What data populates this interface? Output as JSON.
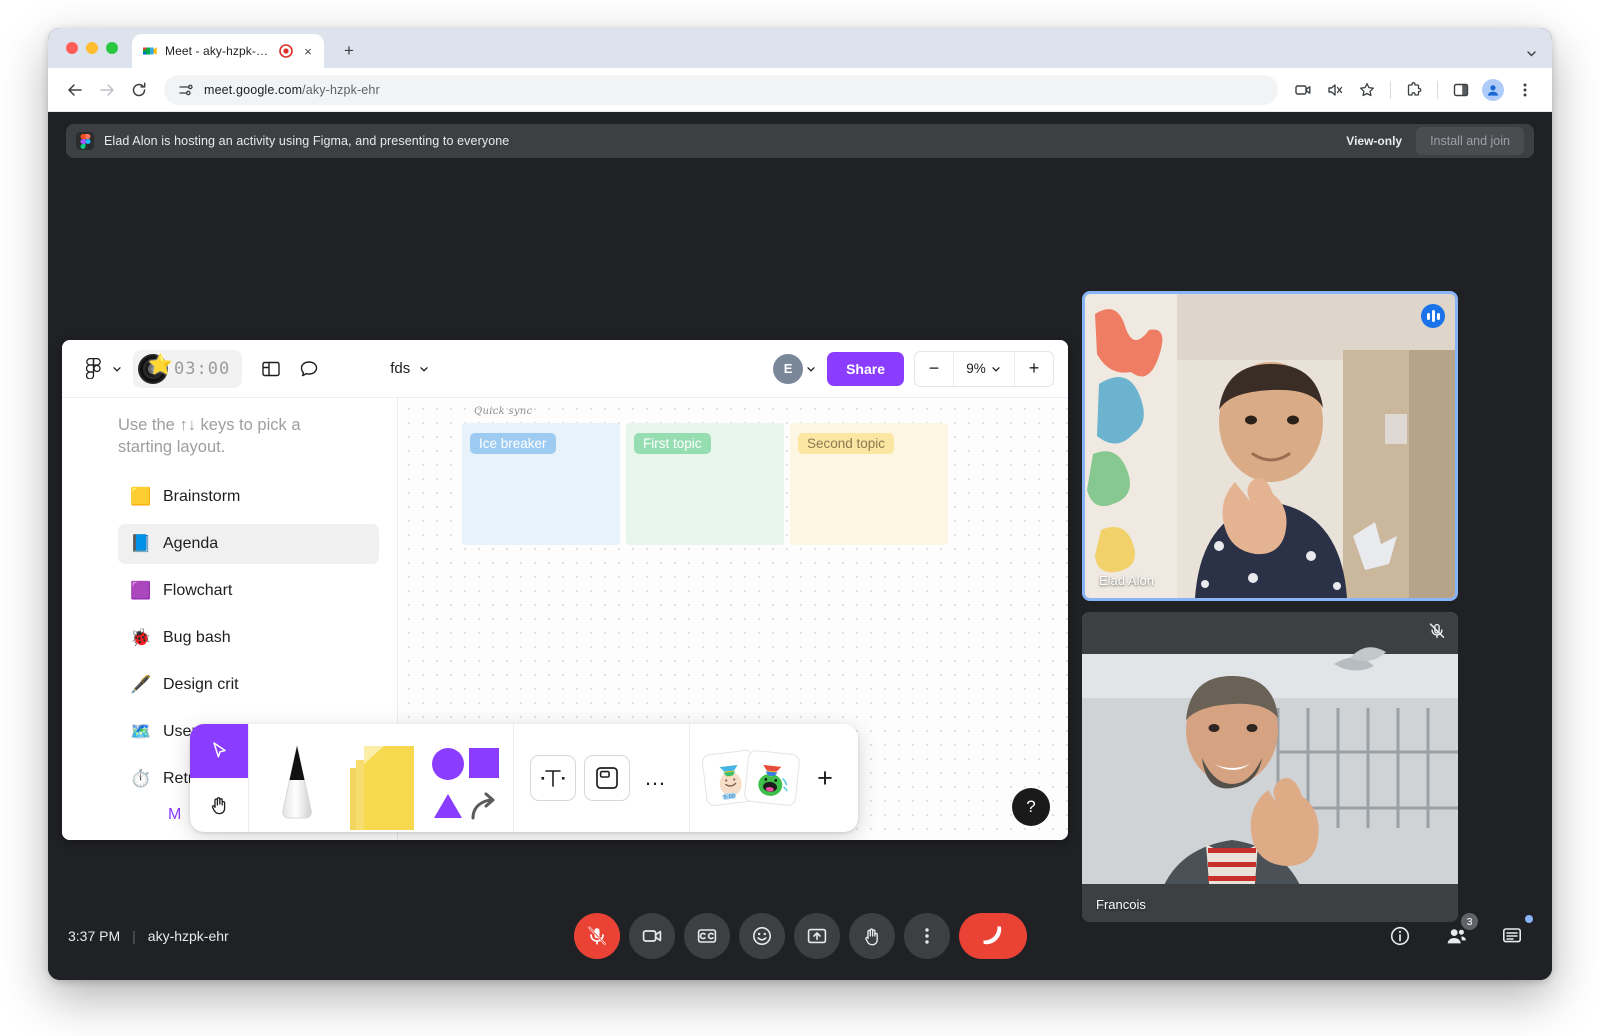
{
  "browser": {
    "tab": {
      "title": "Meet - aky-hzpk-ehr",
      "favicon_name": "google-meet-favicon",
      "recording_indicator": "recording-indicator",
      "close_label": "×"
    },
    "new_tab_label": "+",
    "toolbar": {
      "back_label": "←",
      "forward_label": "→",
      "reload_label": "⟳",
      "url_host": "meet.google.com",
      "url_path": "/aky-hzpk-ehr",
      "actions": [
        "media-cast-icon",
        "mute-site-icon",
        "bookmark-star-icon",
        "extensions-icon",
        "side-panel-icon",
        "profile-avatar-icon",
        "browser-menu-icon"
      ]
    }
  },
  "banner": {
    "app_icon": "figma-icon",
    "message": "Elad Alon is hosting an activity using Figma, and presenting to everyone",
    "view_only_label": "View-only",
    "install_button_label": "Install and join"
  },
  "figma": {
    "toolbar": {
      "logo_name": "figma-logo-icon",
      "logo_chevron": "chevron-down-icon",
      "timer_value": "03:00",
      "timer_sticker": "⭐",
      "layout_icon": "layout-panel-icon",
      "comment_icon": "comment-bubble-icon",
      "document_name": "fds",
      "document_chevron": "chevron-down-icon",
      "avatar_initial": "E",
      "avatar_chevron": "chevron-down-icon",
      "share_label": "Share",
      "zoom_minus": "−",
      "zoom_value": "9%",
      "zoom_chevron": "chevron-down-icon",
      "zoom_plus": "+"
    },
    "panel": {
      "hint": "Use the ↑↓ keys to pick a starting layout.",
      "items": [
        {
          "emoji": "🟨",
          "label": "Brainstorm",
          "selected": false
        },
        {
          "emoji": "📘",
          "label": "Agenda",
          "selected": true
        },
        {
          "emoji": "🟪",
          "label": "Flowchart",
          "selected": false
        },
        {
          "emoji": "🐞",
          "label": "Bug bash",
          "selected": false
        },
        {
          "emoji": "🖋️",
          "label": "Design crit",
          "selected": false
        },
        {
          "emoji": "🗺️",
          "label": "User journey",
          "selected": false
        },
        {
          "emoji": "⏱️",
          "label": "Retro",
          "selected": false
        }
      ],
      "more_label": "M"
    },
    "board": {
      "title": "Quick sync",
      "cards": [
        {
          "label": "Ice breaker"
        },
        {
          "label": "First topic"
        },
        {
          "label": "Second topic"
        }
      ]
    },
    "palette": {
      "select_tool": "cursor-select-icon",
      "hand_tool": "hand-pan-icon",
      "pen_tool": "marker-pen-icon",
      "sticky_note_tool": "sticky-note-icon",
      "shapes_tool": "shapes-icon",
      "text_tool": "T",
      "frame_tool": "frame-icon",
      "more_tools": "…",
      "sticker_one": "party-face-sticker",
      "sticker_two": "party-monster-sticker",
      "add_sticker": "+"
    },
    "help_label": "?"
  },
  "tiles": [
    {
      "name": "Elad Alon",
      "status_icon": "active-speaker-icon",
      "active_speaker": true,
      "muted": false
    },
    {
      "name": "Francois",
      "status_icon": "mic-off-icon",
      "active_speaker": false,
      "muted": true
    }
  ],
  "controls": {
    "time": "3:37 PM",
    "separator": "|",
    "meeting_code": "aky-hzpk-ehr",
    "buttons": [
      {
        "name": "microphone-off-button",
        "icon": "mic-off-icon",
        "state": "muted"
      },
      {
        "name": "camera-button",
        "icon": "video-camera-icon",
        "state": "on"
      },
      {
        "name": "captions-button",
        "icon": "closed-captions-icon",
        "state": "off"
      },
      {
        "name": "emoji-reactions-button",
        "icon": "smiley-face-icon",
        "state": "off"
      },
      {
        "name": "present-screen-button",
        "icon": "present-to-screen-icon",
        "state": "off"
      },
      {
        "name": "raise-hand-button",
        "icon": "raised-hand-icon",
        "state": "off"
      },
      {
        "name": "more-options-button",
        "icon": "three-dots-vertical-icon",
        "state": "off"
      },
      {
        "name": "end-call-button",
        "icon": "hangup-phone-icon",
        "state": "danger"
      }
    ],
    "right_buttons": [
      {
        "name": "meeting-details-button",
        "icon": "info-circle-icon",
        "badge": ""
      },
      {
        "name": "participants-button",
        "icon": "people-icon",
        "badge": "3"
      },
      {
        "name": "chat-button",
        "icon": "chat-bubble-icon",
        "badge": ""
      }
    ]
  },
  "colors": {
    "meet_bg": "#202124",
    "banner_bg": "#3c4043",
    "accent_blue": "#8ab4f8",
    "danger_red": "#ea4335",
    "figma_purple": "#8b3dff"
  }
}
